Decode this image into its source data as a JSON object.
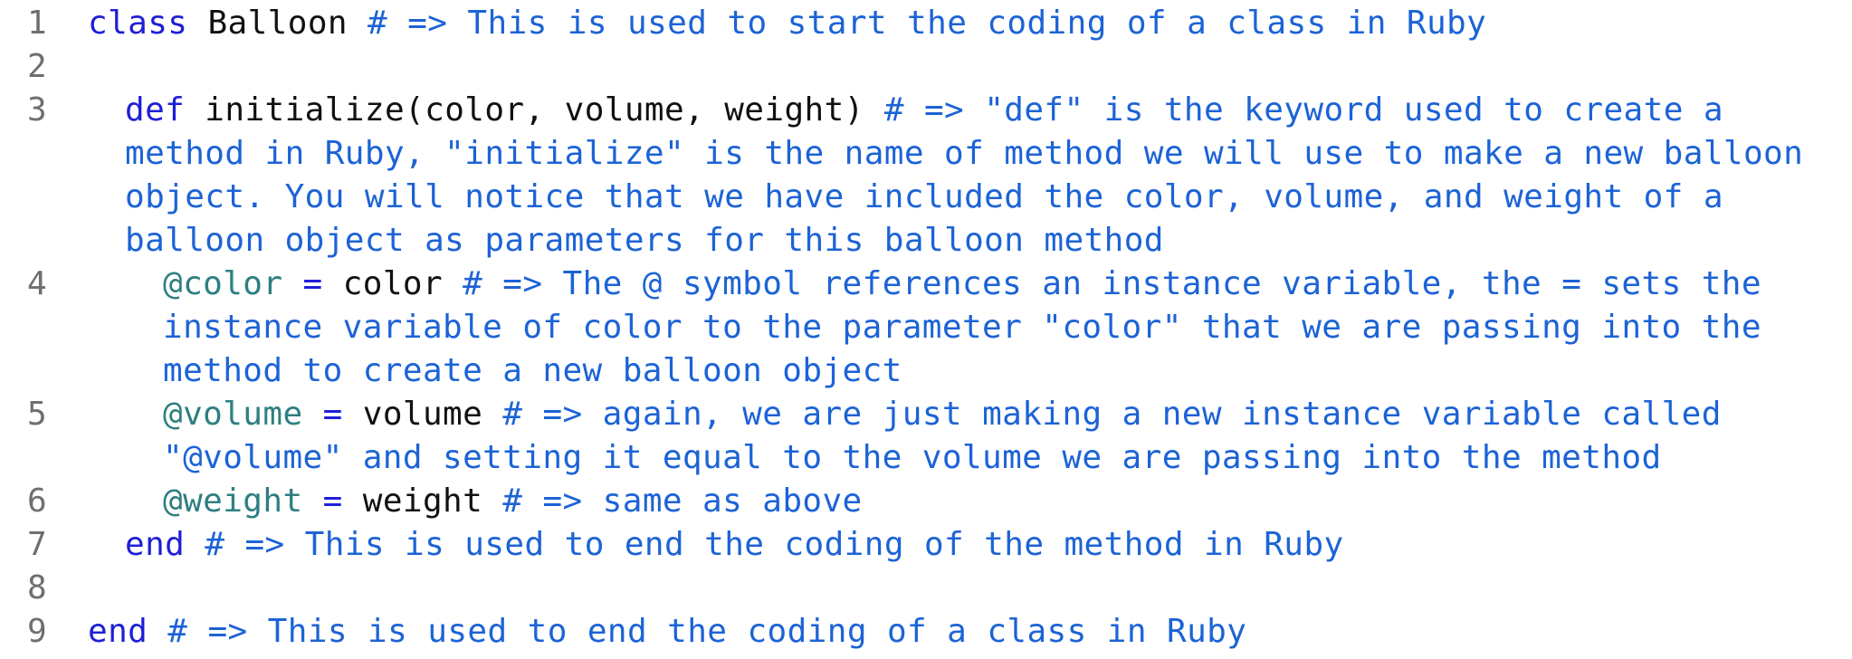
{
  "colors": {
    "keyword": "#1f1fd6",
    "comment": "#1c63d6",
    "instance_variable": "#2e7f81",
    "line_number": "#6f6f6f",
    "plain": "#111111",
    "background": "#ffffff"
  },
  "lines": [
    {
      "number": "1",
      "tokens": {
        "kw": "class",
        "name": " Balloon ",
        "comment": "# => This is used to start the coding of a class in Ruby"
      }
    },
    {
      "number": "2"
    },
    {
      "number": "3",
      "tokens": {
        "kw": "def",
        "name": " initialize(color, volume, weight) ",
        "comment": "# => \"def\" is the keyword used to create a method in Ruby, \"initialize\" is the name of method we will use to make a new balloon object. You will notice that we have included the color, volume, and weight of a balloon object as parameters for this balloon method"
      }
    },
    {
      "number": "4",
      "tokens": {
        "ivar": "@color",
        "op": " = ",
        "name": "color ",
        "comment": "# => The @ symbol references an instance variable, the = sets the instance variable of color to the parameter \"color\" that we are passing into the method to create a new balloon object"
      }
    },
    {
      "number": "5",
      "tokens": {
        "ivar": "@volume",
        "op": " = ",
        "name": "volume ",
        "comment": "# => again, we are just making a new instance variable called \"@volume\" and setting it equal to the volume we are passing into the method"
      }
    },
    {
      "number": "6",
      "tokens": {
        "ivar": "@weight",
        "op": " = ",
        "name": "weight ",
        "comment": "# => same as above"
      }
    },
    {
      "number": "7",
      "tokens": {
        "kw": "end",
        "comment": " # => This is used to end the coding of the method in Ruby"
      }
    },
    {
      "number": "8"
    },
    {
      "number": "9",
      "tokens": {
        "kw": "end",
        "comment": " # => This is used to end the coding of a class in Ruby"
      }
    }
  ]
}
